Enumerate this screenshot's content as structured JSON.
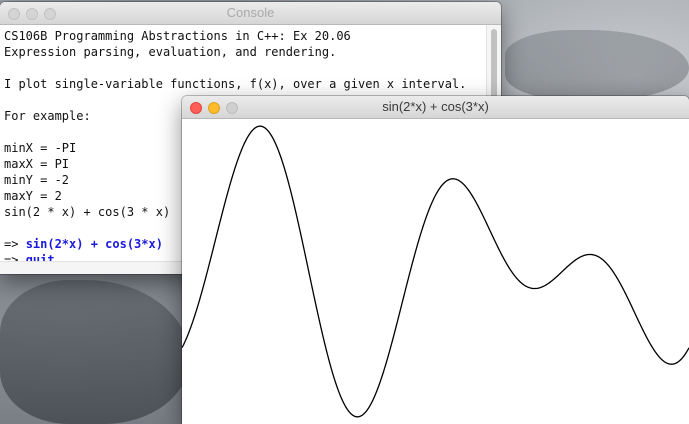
{
  "console": {
    "title": "Console",
    "lines": [
      {
        "text": "CS106B Programming Abstractions in C++: Ex 20.06",
        "kind": "output"
      },
      {
        "text": "Expression parsing, evaluation, and rendering.",
        "kind": "output"
      },
      {
        "text": "",
        "kind": "output"
      },
      {
        "text": "I plot single-variable functions, f(x), over a given x interval.",
        "kind": "output"
      },
      {
        "text": "",
        "kind": "output"
      },
      {
        "text": "For example:",
        "kind": "output"
      },
      {
        "text": "",
        "kind": "output"
      },
      {
        "text": "minX = -PI",
        "kind": "output"
      },
      {
        "text": "maxX = PI",
        "kind": "output"
      },
      {
        "text": "minY = -2",
        "kind": "output"
      },
      {
        "text": "maxY = 2",
        "kind": "output"
      },
      {
        "text": "sin(2 * x) + cos(3 * x)",
        "kind": "output"
      },
      {
        "text": "",
        "kind": "output"
      },
      {
        "prompt": "=> ",
        "text": "sin(2*x) + cos(3*x)",
        "kind": "input"
      },
      {
        "prompt": "=> ",
        "text": "quit",
        "kind": "input"
      }
    ]
  },
  "graph": {
    "title": "sin(2*x) + cos(3*x)",
    "curve_color": "#000000"
  },
  "chart_data": {
    "type": "line",
    "series": [
      {
        "expression": "sin(2*x) + cos(3*x)"
      }
    ],
    "xlim": [
      -3.14159,
      3.14159
    ],
    "ylim": [
      -2,
      2
    ],
    "grid": false
  },
  "colors": {
    "close": "#fc5f57",
    "minimize": "#fdbc2e",
    "zoom_inactive": "#cfcfcf",
    "command_text": "#1a1adc"
  }
}
